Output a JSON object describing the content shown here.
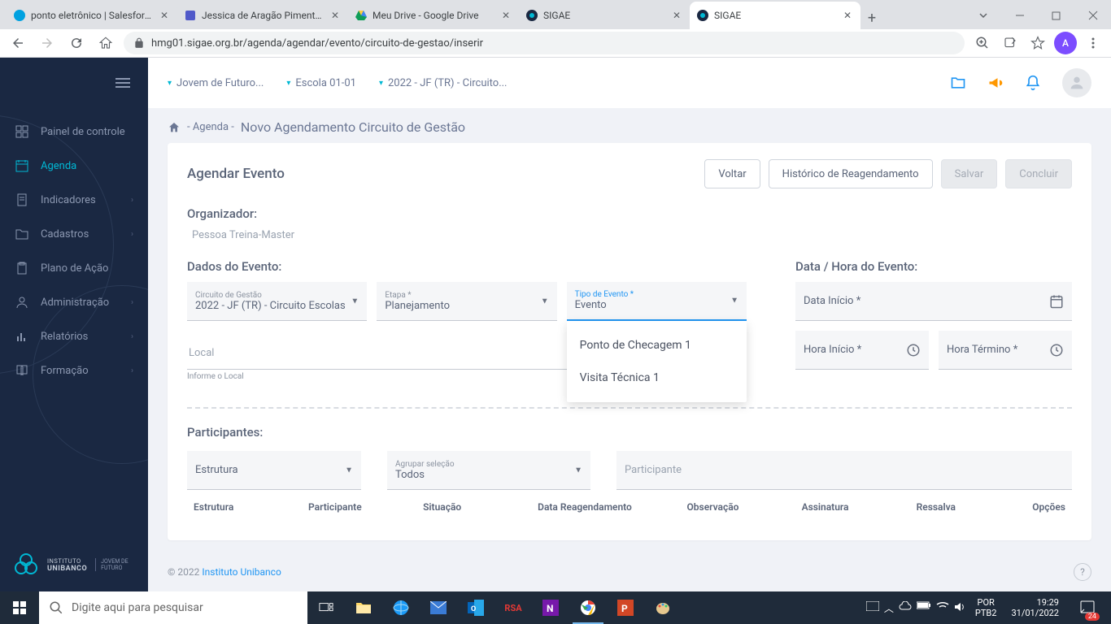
{
  "browser": {
    "tabs": [
      {
        "title": "ponto eletrônico | Salesforce",
        "favicon_color": "#00a1e0"
      },
      {
        "title": "Jessica de Aragão Pimenta | ",
        "favicon_color": "#5059c9"
      },
      {
        "title": "Meu Drive - Google Drive",
        "favicon_color": "#0f9d58"
      },
      {
        "title": "SIGAE",
        "favicon_color": "#1a2842"
      },
      {
        "title": "SIGAE",
        "favicon_color": "#1a2842"
      }
    ],
    "url": "hmg01.sigae.org.br/agenda/agendar/evento/circuito-de-gestao/inserir",
    "profile_letter": "A"
  },
  "sidebar": {
    "items": [
      {
        "label": "Painel de controle"
      },
      {
        "label": "Agenda"
      },
      {
        "label": "Indicadores"
      },
      {
        "label": "Cadastros"
      },
      {
        "label": "Plano de Ação"
      },
      {
        "label": "Administração"
      },
      {
        "label": "Relatórios"
      },
      {
        "label": "Formação"
      }
    ],
    "logo_line1": "INSTITUTO",
    "logo_line2": "UNIBANCO",
    "logo_sub": "JOVEM DE FUTURO"
  },
  "topbar": {
    "crumb0": "Jovem de Futuro...",
    "crumb1": "Escola 01-01",
    "crumb2": "2022 - JF (TR) - Circuito..."
  },
  "breadcrumb": {
    "root": "- Agenda -",
    "current": "Novo Agendamento Circuito de Gestão"
  },
  "card": {
    "title": "Agendar Evento",
    "btn_voltar": "Voltar",
    "btn_hist": "Histórico de Reagendamento",
    "btn_salvar": "Salvar",
    "btn_concluir": "Concluir"
  },
  "organizer": {
    "label": "Organizador:",
    "value": "Pessoa Treina-Master"
  },
  "evento": {
    "section": "Dados do Evento:",
    "circuito_label": "Circuito de Gestão",
    "circuito_value": "2022 - JF (TR) - Circuito Escolas",
    "etapa_label": "Etapa *",
    "etapa_value": "Planejamento",
    "tipo_label": "Tipo de Evento *",
    "tipo_value": "Evento",
    "tipo_options": [
      "Ponto de Checagem 1",
      "Visita Técnica 1"
    ],
    "local_label": "Local",
    "local_helper": "Informe o Local"
  },
  "datahora": {
    "section": "Data / Hora do Evento:",
    "data_inicio": "Data Início *",
    "hora_inicio": "Hora Início *",
    "hora_termino": "Hora Término *"
  },
  "participantes": {
    "section": "Participantes:",
    "estrutura": "Estrutura",
    "agrupar_label": "Agrupar seleção",
    "agrupar_value": "Todos",
    "participante": "Participante",
    "th": [
      "Estrutura",
      "Participante",
      "Situação",
      "Data Reagendamento",
      "Observação",
      "Assinatura",
      "Ressalva",
      "Opções"
    ]
  },
  "footer": {
    "copyright": "© 2022 ",
    "link": "Instituto Unibanco"
  },
  "taskbar": {
    "search_placeholder": "Digite aqui para pesquisar",
    "rsa": "RSA",
    "lang1": "POR",
    "lang2": "PTB2",
    "time": "19:29",
    "date": "31/01/2022",
    "notif_count": "24"
  }
}
